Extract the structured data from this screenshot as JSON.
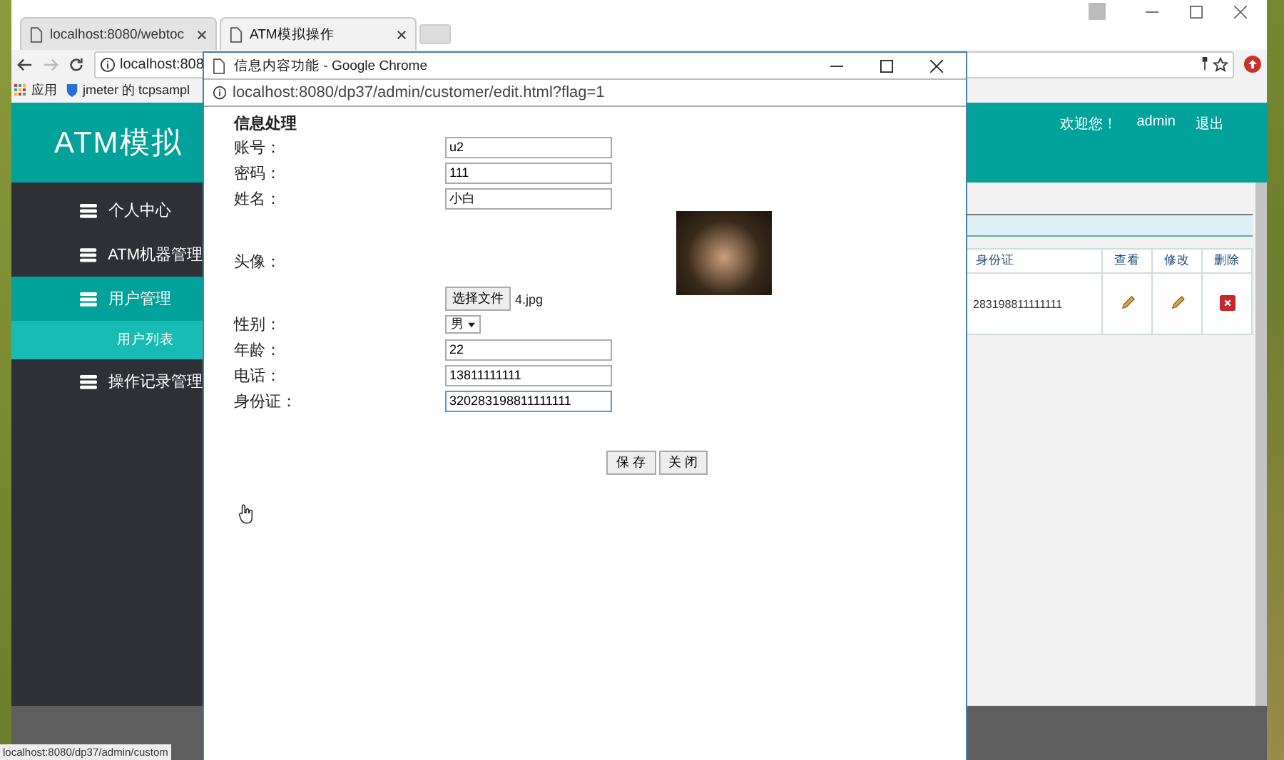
{
  "browser": {
    "tabs": [
      {
        "title": "localhost:8080/webtoc",
        "selected": false
      },
      {
        "title": "ATM模拟操作",
        "selected": true
      }
    ],
    "address": "localhost:808",
    "bookmarks": [
      {
        "label": "应用"
      },
      {
        "label": "jmeter 的 tcpsampl"
      }
    ],
    "status_url": "localhost:8080/dp37/admin/custom"
  },
  "site": {
    "title": "ATM模拟",
    "welcome": "欢迎您！",
    "user": "admin",
    "logout": "退出"
  },
  "sidebar": {
    "items": [
      {
        "label": "个人中心",
        "selected": false
      },
      {
        "label": "ATM机器管理",
        "selected": false
      },
      {
        "label": "用户管理",
        "selected": true,
        "children": [
          {
            "label": "用户列表",
            "selected": true
          }
        ]
      },
      {
        "label": "操作记录管理",
        "selected": false
      }
    ]
  },
  "table": {
    "columns": [
      "身份证",
      "查看",
      "修改",
      "删除"
    ],
    "rows": [
      {
        "id_card": "283198811111111"
      }
    ]
  },
  "popup": {
    "title": "信息内容功能 - Google Chrome",
    "url": "localhost:8080/dp37/admin/customer/edit.html?flag=1",
    "heading": "信息处理",
    "fields": [
      {
        "kind": "text",
        "label": "账号：",
        "value": "u2",
        "focused": false
      },
      {
        "kind": "text",
        "label": "密码：",
        "value": "111",
        "focused": false
      },
      {
        "kind": "text",
        "label": "姓名：",
        "value": "小白",
        "focused": false
      },
      {
        "kind": "image",
        "label": "头像：",
        "button": "选择文件",
        "file": "4.jpg"
      },
      {
        "kind": "select",
        "label": "性别：",
        "value": "男"
      },
      {
        "kind": "text",
        "label": "年龄：",
        "value": "22",
        "focused": false
      },
      {
        "kind": "text",
        "label": "电话：",
        "value": "13811111111",
        "focused": false
      },
      {
        "kind": "text",
        "label": "身份证：",
        "value": "320283198811111111",
        "focused": true
      }
    ],
    "buttons": [
      "保 存",
      "关 闭"
    ]
  }
}
